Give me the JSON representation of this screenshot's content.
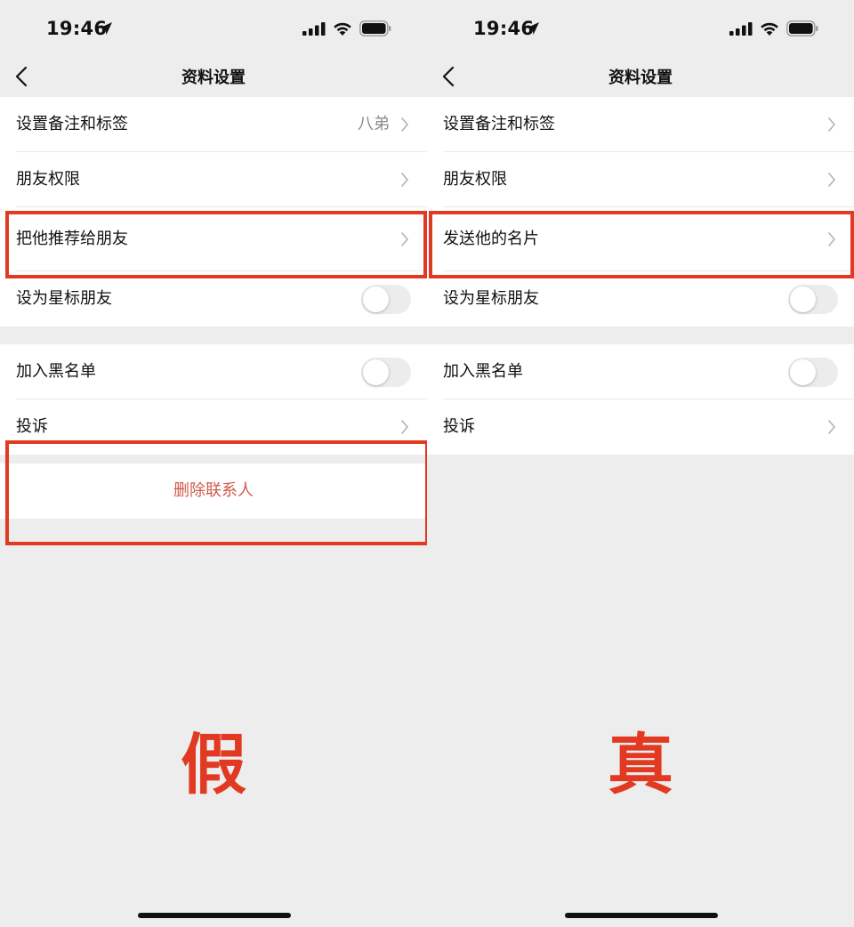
{
  "colors": {
    "background": "#ededed",
    "highlight": "#e23a22",
    "danger_text": "#d05a4a",
    "big_label": "#e23a22"
  },
  "left": {
    "status_bar": {
      "time": "19:46"
    },
    "nav": {
      "title": "资料设置"
    },
    "rows": {
      "remark_label": "设置备注和标签",
      "remark_value": "八弟",
      "permission_label": "朋友权限",
      "recommend_label": "把他推荐给朋友",
      "star_label": "设为星标朋友",
      "blacklist_label": "加入黑名单",
      "complain_label": "投诉"
    },
    "toggles": {
      "star_on": false,
      "blacklist_on": false
    },
    "delete_label": "删除联系人",
    "big_label": "假"
  },
  "right": {
    "status_bar": {
      "time": "19:46"
    },
    "nav": {
      "title": "资料设置"
    },
    "rows": {
      "remark_label": "设置备注和标签",
      "permission_label": "朋友权限",
      "send_card_label": "发送他的名片",
      "star_label": "设为星标朋友",
      "blacklist_label": "加入黑名单",
      "complain_label": "投诉"
    },
    "toggles": {
      "star_on": false,
      "blacklist_on": false
    },
    "big_label": "真"
  },
  "icons": [
    "location-arrow-icon",
    "signal-icon",
    "wifi-icon",
    "battery-icon",
    "back-chevron-icon",
    "chevron-right-icon"
  ]
}
